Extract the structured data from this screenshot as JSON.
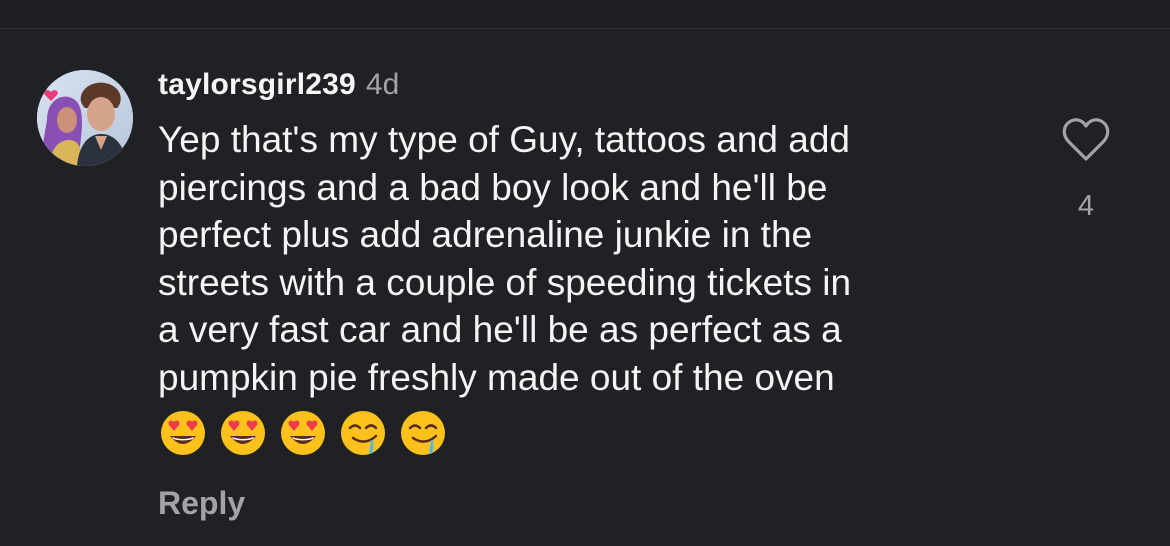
{
  "comment": {
    "username": "taylorsgirl239",
    "timestamp": "4d",
    "text": "Yep that's my type of Guy, tattoos and add\npiercings and a bad boy look and he'll be\nperfect plus add adrenaline junkie in the\nstreets with a couple of speeding tickets in\na very fast car and he'll be as perfect as a\npumpkin pie freshly made out of the oven",
    "emojis": [
      "smiling-face-with-heart-eyes",
      "smiling-face-with-heart-eyes",
      "smiling-face-with-heart-eyes",
      "drooling-face",
      "drooling-face"
    ],
    "reply_label": "Reply",
    "like_count": "4",
    "like_icon": "heart-outline-icon"
  },
  "colors": {
    "background": "#202125",
    "primary_text": "#f5f5f5",
    "secondary_text": "#a2a3a7"
  }
}
